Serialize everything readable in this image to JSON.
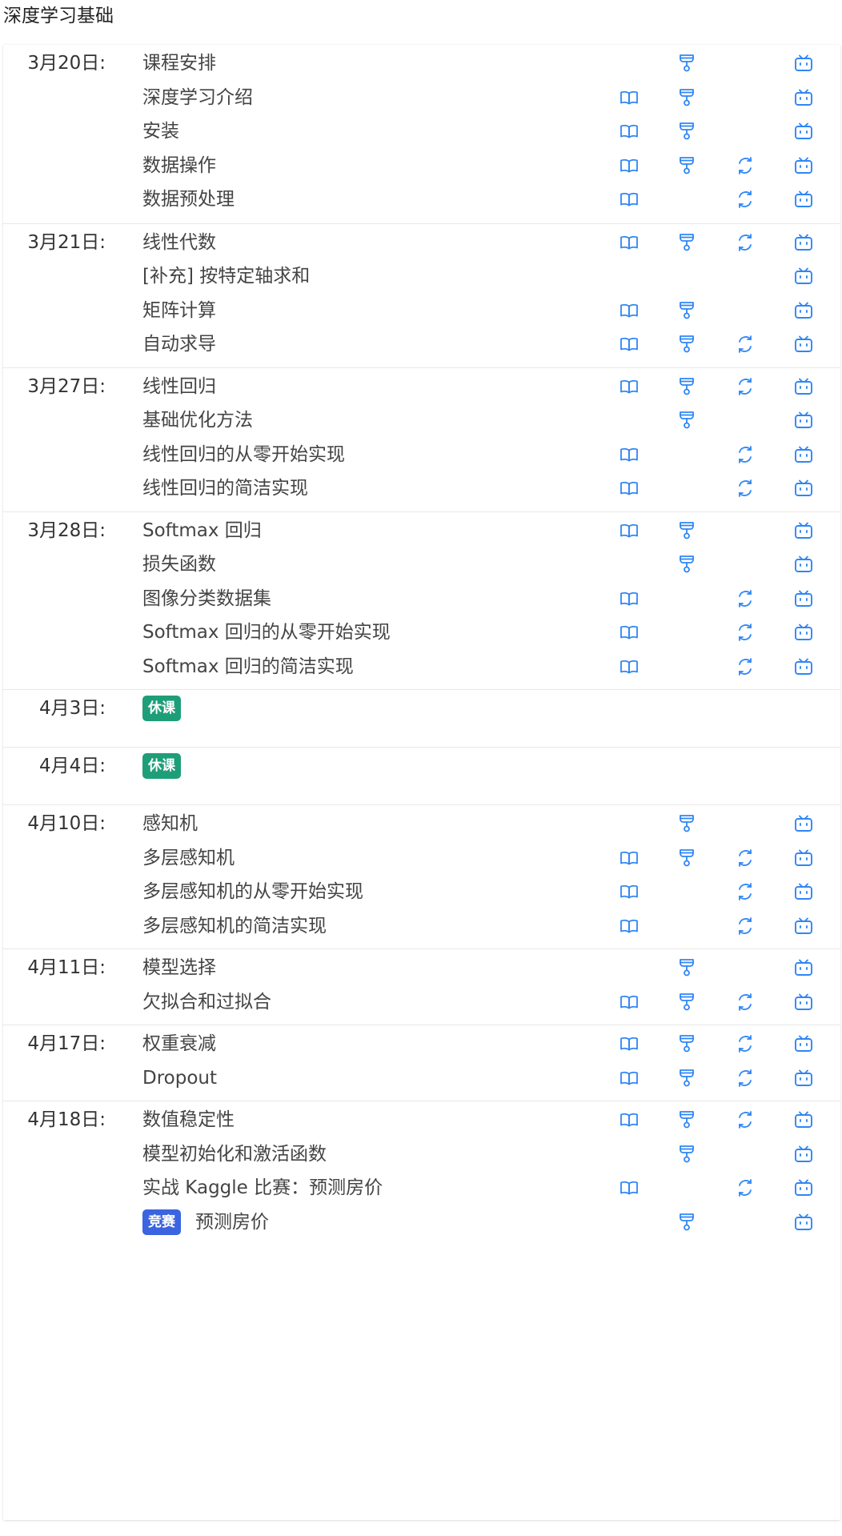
{
  "page": {
    "title": "深度学习基础"
  },
  "colors": {
    "icon": "#2f86f6",
    "rest_badge": "#1e9e78",
    "comp_badge": "#3b64e0"
  },
  "icons": {
    "book": "book-icon",
    "slides": "presentation-icon",
    "code": "refresh-code-icon",
    "video": "bilibili-tv-icon"
  },
  "schedule": [
    {
      "date": "3月20日:",
      "items": [
        {
          "title": "课程安排",
          "icons": [
            "slides",
            "video"
          ]
        },
        {
          "title": "深度学习介绍",
          "icons": [
            "book",
            "slides",
            "video"
          ]
        },
        {
          "title": "安装",
          "icons": [
            "book",
            "slides",
            "video"
          ]
        },
        {
          "title": "数据操作",
          "icons": [
            "book",
            "slides",
            "code",
            "video"
          ]
        },
        {
          "title": "数据预处理",
          "icons": [
            "book",
            "code",
            "video"
          ]
        }
      ]
    },
    {
      "date": "3月21日:",
      "items": [
        {
          "title": "线性代数",
          "icons": [
            "book",
            "slides",
            "code",
            "video"
          ]
        },
        {
          "title": "[补充] 按特定轴求和",
          "icons": [
            "video"
          ]
        },
        {
          "title": "矩阵计算",
          "icons": [
            "book",
            "slides",
            "video"
          ]
        },
        {
          "title": "自动求导",
          "icons": [
            "book",
            "slides",
            "code",
            "video"
          ]
        }
      ]
    },
    {
      "date": "3月27日:",
      "items": [
        {
          "title": "线性回归",
          "icons": [
            "book",
            "slides",
            "code",
            "video"
          ]
        },
        {
          "title": "基础优化方法",
          "icons": [
            "slides",
            "video"
          ]
        },
        {
          "title": "线性回归的从零开始实现",
          "icons": [
            "book",
            "code",
            "video"
          ]
        },
        {
          "title": "线性回归的简洁实现",
          "icons": [
            "book",
            "code",
            "video"
          ]
        }
      ]
    },
    {
      "date": "3月28日:",
      "items": [
        {
          "title": "Softmax 回归",
          "icons": [
            "book",
            "slides",
            "video"
          ]
        },
        {
          "title": "损失函数",
          "icons": [
            "slides",
            "video"
          ]
        },
        {
          "title": "图像分类数据集",
          "icons": [
            "book",
            "code",
            "video"
          ]
        },
        {
          "title": "Softmax 回归的从零开始实现",
          "icons": [
            "book",
            "code",
            "video"
          ]
        },
        {
          "title": "Softmax 回归的简洁实现",
          "icons": [
            "book",
            "code",
            "video"
          ]
        }
      ]
    },
    {
      "date": "4月3日:",
      "rest": true,
      "items": [
        {
          "title": "",
          "badge": "休课",
          "badge_type": "rest",
          "icons": []
        }
      ]
    },
    {
      "date": "4月4日:",
      "rest": true,
      "items": [
        {
          "title": "",
          "badge": "休课",
          "badge_type": "rest",
          "icons": []
        }
      ]
    },
    {
      "date": "4月10日:",
      "items": [
        {
          "title": "感知机",
          "icons": [
            "slides",
            "video"
          ]
        },
        {
          "title": "多层感知机",
          "icons": [
            "book",
            "slides",
            "code",
            "video"
          ]
        },
        {
          "title": "多层感知机的从零开始实现",
          "icons": [
            "book",
            "code",
            "video"
          ]
        },
        {
          "title": "多层感知机的简洁实现",
          "icons": [
            "book",
            "code",
            "video"
          ]
        }
      ]
    },
    {
      "date": "4月11日:",
      "items": [
        {
          "title": "模型选择",
          "icons": [
            "slides",
            "video"
          ]
        },
        {
          "title": "欠拟合和过拟合",
          "icons": [
            "book",
            "slides",
            "code",
            "video"
          ]
        }
      ]
    },
    {
      "date": "4月17日:",
      "items": [
        {
          "title": "权重衰减",
          "icons": [
            "book",
            "slides",
            "code",
            "video"
          ]
        },
        {
          "title": "Dropout",
          "icons": [
            "book",
            "slides",
            "code",
            "video"
          ]
        }
      ]
    },
    {
      "date": "4月18日:",
      "items": [
        {
          "title": "数值稳定性",
          "icons": [
            "book",
            "slides",
            "code",
            "video"
          ]
        },
        {
          "title": "模型初始化和激活函数",
          "icons": [
            "slides",
            "video"
          ]
        },
        {
          "title": "实战 Kaggle 比赛：预测房价",
          "icons": [
            "book",
            "code",
            "video"
          ]
        },
        {
          "title": "预测房价",
          "badge": "竞赛",
          "badge_type": "comp",
          "icons": [
            "slides",
            "video"
          ]
        }
      ]
    }
  ]
}
